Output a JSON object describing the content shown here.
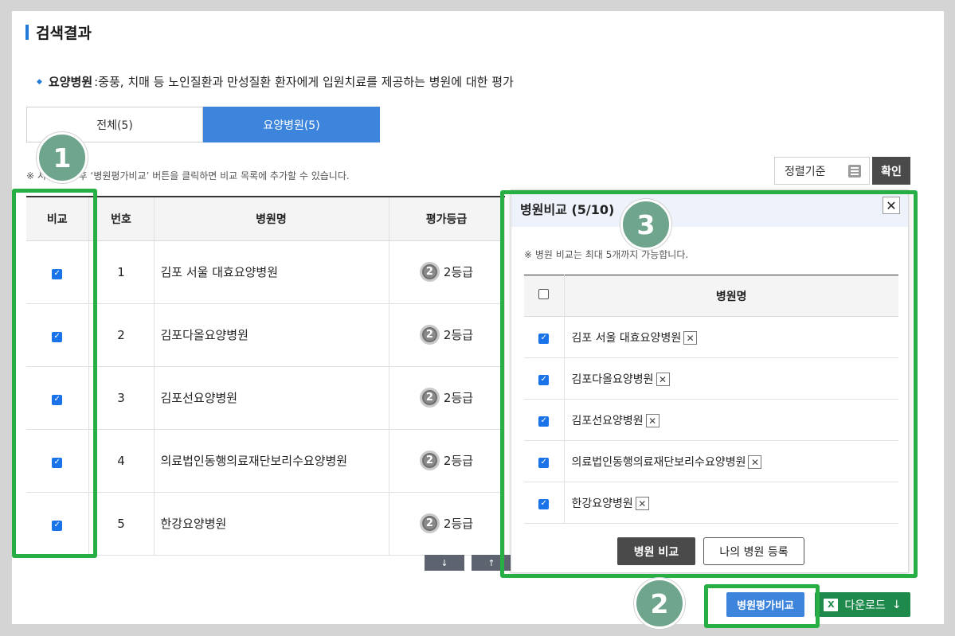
{
  "section_title": "검색결과",
  "description": {
    "label": "요양병원",
    "text": ":중풍, 치매 등 노인질환과 만성질환 환자에게 입원치료를 제공하는 병원에 대한 평가"
  },
  "tabs": [
    {
      "label": "전체(5)",
      "active": false
    },
    {
      "label": "요양병원(5)",
      "active": true
    }
  ],
  "note": "※ 시설 선택 후 ‘병원평가비교’ 버튼을 클릭하면 비교 목록에 추가할 수 있습니다.",
  "sort": {
    "label": "정렬기준",
    "confirm": "확인"
  },
  "table": {
    "headers": [
      "비교",
      "번호",
      "병원명",
      "평가등급"
    ],
    "rows": [
      {
        "checked": true,
        "no": "1",
        "name": "김포 서울 대효요양병원",
        "grade_num": "2",
        "grade": "2등급"
      },
      {
        "checked": true,
        "no": "2",
        "name": "김포다올요양병원",
        "grade_num": "2",
        "grade": "2등급"
      },
      {
        "checked": true,
        "no": "3",
        "name": "김포선요양병원",
        "grade_num": "2",
        "grade": "2등급"
      },
      {
        "checked": true,
        "no": "4",
        "name": "의료법인동행의료재단보리수요양병원",
        "grade_num": "2",
        "grade": "2등급"
      },
      {
        "checked": true,
        "no": "5",
        "name": "한강요양병원",
        "grade_num": "2",
        "grade": "2등급"
      }
    ]
  },
  "arrows": {
    "down": "↓",
    "up": "↑"
  },
  "compare_panel": {
    "title": "병원비교 (5/10)",
    "close": "✕",
    "note": "※ 병원 비교는 최대 5개까지 가능합니다.",
    "header": "병원명",
    "items": [
      {
        "checked": true,
        "name": "김포 서울 대효요양병원"
      },
      {
        "checked": true,
        "name": "김포다올요양병원"
      },
      {
        "checked": true,
        "name": "김포선요양병원"
      },
      {
        "checked": true,
        "name": "의료법인동행의료재단보리수요양병원"
      },
      {
        "checked": true,
        "name": "한강요양병원"
      }
    ],
    "compare_button": "병원 비교",
    "register_button": "나의 병원 등록"
  },
  "bottom": {
    "compare_button": "병원평가비교",
    "download_button": "다운로드",
    "download_arrow": "↓",
    "excel_glyph": "X"
  },
  "step_markers": [
    "1",
    "2",
    "3"
  ],
  "colors": {
    "accent": "#3c84dc",
    "highlight": "#27ae45",
    "marker": "#6fa58d",
    "excel": "#1e8a4c"
  }
}
